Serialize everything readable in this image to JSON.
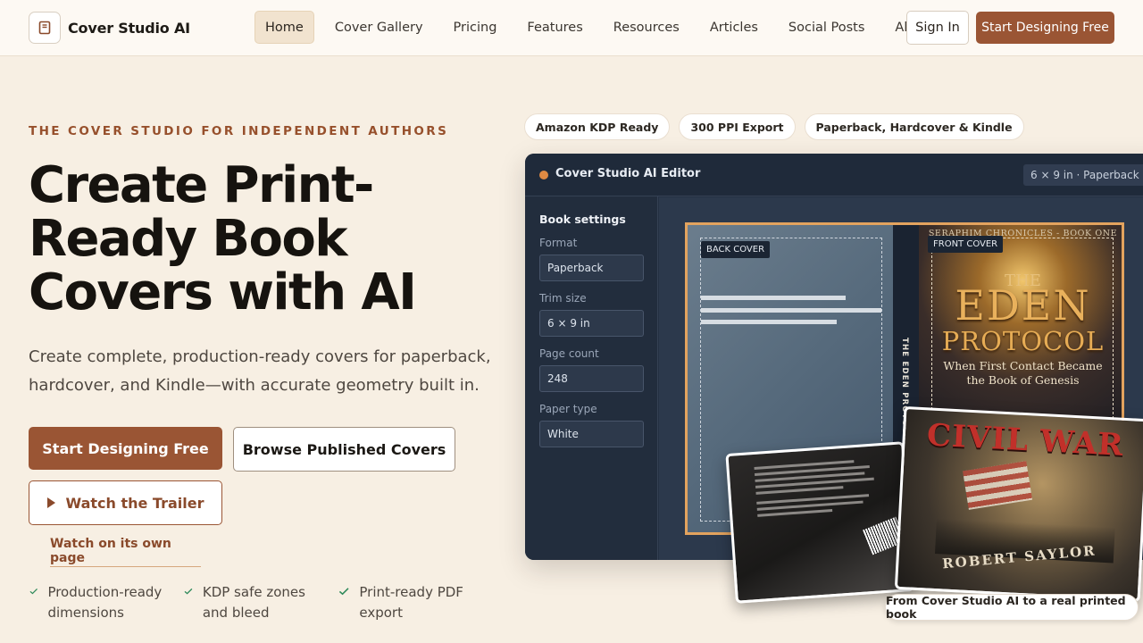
{
  "nav": {
    "brand": "Cover Studio AI",
    "links": [
      "Home",
      "Cover Gallery",
      "Pricing",
      "Features",
      "Resources",
      "Articles",
      "Social Posts",
      "About"
    ],
    "sign_in": "Sign In",
    "cta": "Start Designing Free"
  },
  "hero": {
    "eyebrow": "THE COVER STUDIO FOR INDEPENDENT AUTHORS",
    "headline": "Create Print-Ready Book Covers with AI",
    "lede": "Create complete, production-ready covers for paperback, hardcover, and Kindle—with accurate geometry built in.",
    "primary_cta": "Start Designing Free",
    "secondary_cta": "Browse Published Covers",
    "trailer_cta": "Watch the Trailer",
    "watch_link": "Watch on its own page",
    "features": [
      "Production-ready dimensions",
      "KDP safe zones and bleed",
      "Print-ready PDF export"
    ]
  },
  "chips": [
    "Amazon KDP Ready",
    "300 PPI Export",
    "Paperback, Hardcover & Kindle"
  ],
  "editor": {
    "title": "Cover Studio AI Editor",
    "badge": "6 × 9 in · Paperback",
    "settings_title": "Book settings",
    "fields": [
      {
        "label": "Format",
        "value": "Paperback"
      },
      {
        "label": "Trim size",
        "value": "6 × 9 in"
      },
      {
        "label": "Page count",
        "value": "248"
      },
      {
        "label": "Paper type",
        "value": "White"
      }
    ],
    "back_tag": "BACK COVER",
    "front_tag": "FRONT COVER",
    "spine_text": "THE EDEN PROTOCOL",
    "series": "SERAPHIM CHRONICLES - BOOK ONE",
    "cover_the": "THE",
    "cover_eden": "EDEN",
    "cover_protocol": "PROTOCOL",
    "cover_subtitle": "When First Contact Became the Book of Genesis"
  },
  "photos": {
    "front_title": "CIVIL WAR",
    "front_author": "ROBERT SAYLOR",
    "caption": "From Cover Studio AI to a real printed book"
  },
  "colors": {
    "accent": "#9a5534",
    "background": "#f7efe3",
    "editor_bg": "#243042",
    "guide": "#e3a35e",
    "check": "#2f8a5b"
  }
}
